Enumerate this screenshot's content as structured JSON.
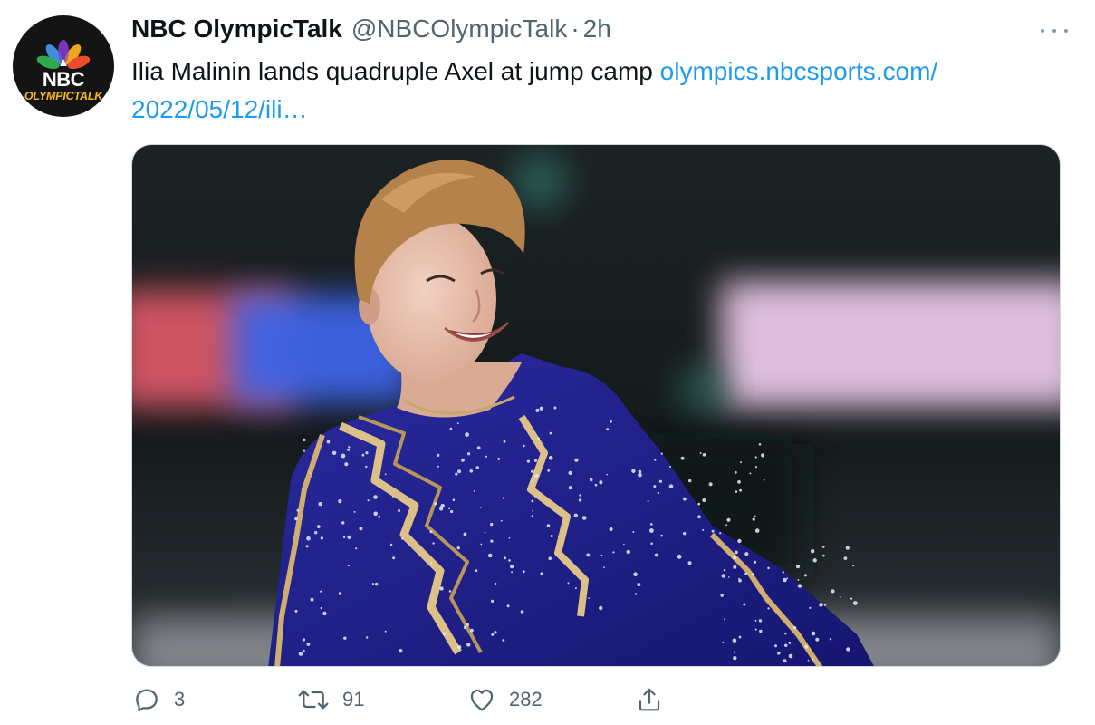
{
  "tweet": {
    "display_name": "NBC OlympicTalk",
    "handle": "@NBCOlympicTalk",
    "separator": "·",
    "time": "2h",
    "text": "Ilia Malinin lands quadruple Axel at jump camp ",
    "link_text": "olympics.nbcsports.com/ 2022/05/12/ili…"
  },
  "avatar": {
    "logo_text": "NBC",
    "sub_text": "OLYMPICTALK"
  },
  "actions": {
    "reply_count": "3",
    "retweet_count": "91",
    "like_count": "282"
  },
  "icons": {
    "avatar": "nbc-peacock-logo",
    "more": "more-horizontal-icon",
    "reply": "reply-icon",
    "retweet": "retweet-icon",
    "like": "heart-icon",
    "share": "share-icon"
  },
  "colors": {
    "text": "#0f1419",
    "secondary": "#536471",
    "link": "#1d9bf0",
    "costume": "#1e1c8c",
    "costume_trim": "#d8b878"
  }
}
